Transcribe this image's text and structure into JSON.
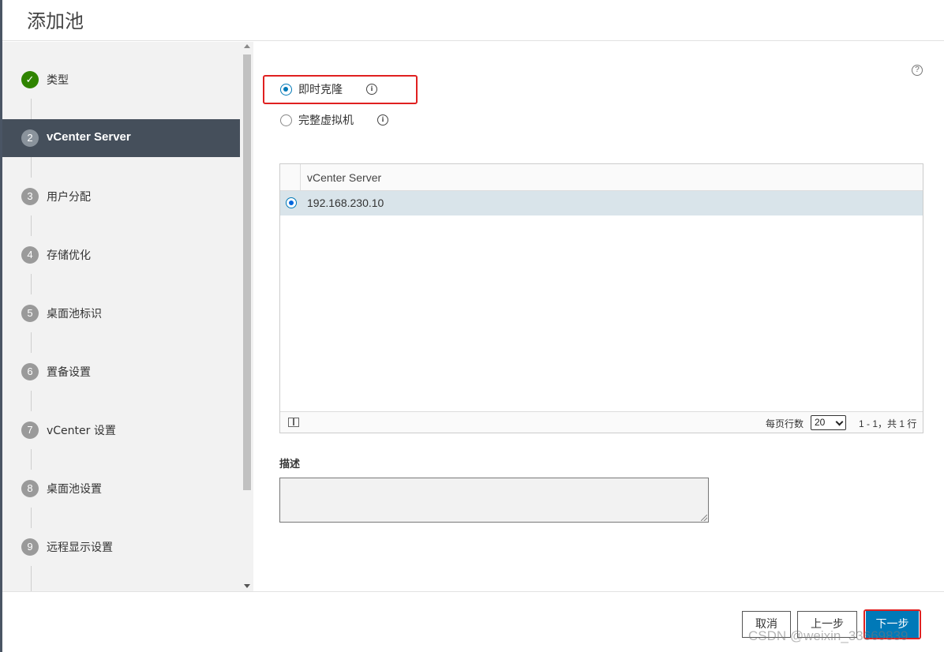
{
  "header": {
    "title": "添加池"
  },
  "sidebar": {
    "steps": [
      {
        "number": "✓",
        "label": "类型",
        "state": "done"
      },
      {
        "number": "2",
        "label": "vCenter Server",
        "state": "active"
      },
      {
        "number": "3",
        "label": "用户分配",
        "state": "pending"
      },
      {
        "number": "4",
        "label": "存储优化",
        "state": "pending"
      },
      {
        "number": "5",
        "label": "桌面池标识",
        "state": "pending"
      },
      {
        "number": "6",
        "label": "置备设置",
        "state": "pending"
      },
      {
        "number": "7",
        "label": "vCenter 设置",
        "state": "pending"
      },
      {
        "number": "8",
        "label": "桌面池设置",
        "state": "pending"
      },
      {
        "number": "9",
        "label": "远程显示设置",
        "state": "pending"
      }
    ]
  },
  "main": {
    "help_icon": "?",
    "clone_options": [
      {
        "label": "即时克隆",
        "selected": true,
        "info_icon": "i"
      },
      {
        "label": "完整虚拟机",
        "selected": false,
        "info_icon": "i"
      }
    ],
    "grid": {
      "column_header": "vCenter Server",
      "rows": [
        {
          "value": "192.168.230.10",
          "selected": true
        }
      ],
      "footer": {
        "per_page_label": "每页行数",
        "per_page_value": "20",
        "range_label": "1 - 1，共 1 行"
      }
    },
    "description": {
      "label": "描述",
      "value": ""
    }
  },
  "footer": {
    "cancel_label": "取消",
    "prev_label": "上一步",
    "next_label": "下一步"
  },
  "watermark": "CSDN @weixin_33669839",
  "colors": {
    "accent": "#0079b8",
    "active_step_bg": "#454f5b",
    "done_step": "#2f8400",
    "highlight": "#e02020"
  }
}
